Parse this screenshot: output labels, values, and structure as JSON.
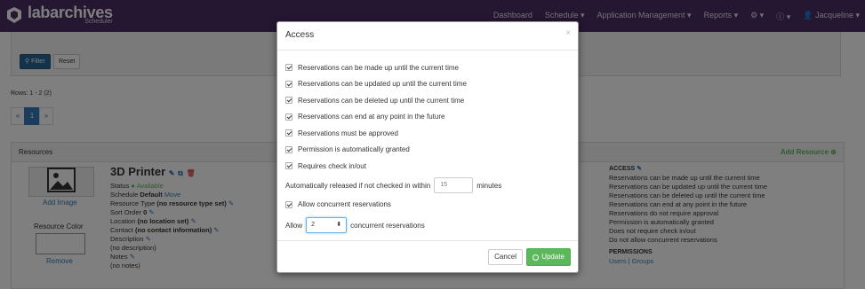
{
  "brand": {
    "name": "labarchives",
    "sub": "Scheduler"
  },
  "nav": {
    "items": [
      "Dashboard",
      "Schedule ▾",
      "Application Management ▾",
      "Reports ▾",
      "⚙ ▾",
      "ⓘ ▾",
      "👤 Jacqueline ▾"
    ]
  },
  "filters": {
    "filter_label": "Filter",
    "reset_label": "Reset"
  },
  "rows_label": "Rows: 1 - 2 (2)",
  "pager": {
    "prev": "«",
    "current": "1",
    "next": "»"
  },
  "resources": {
    "heading": "Resources",
    "add_label": "Add Resource",
    "add_image": "Add Image",
    "resource_color": "Resource Color",
    "remove": "Remove",
    "name": "3D Printer",
    "status_label": "Status",
    "status_value": "Available",
    "schedule_label": "Schedule",
    "schedule_value": "Default",
    "schedule_move": "Move",
    "type_label": "Resource Type",
    "type_value": "(no resource type set)",
    "sort_label": "Sort Order",
    "sort_value": "0",
    "location_label": "Location",
    "location_value": "(no location set)",
    "contact_label": "Contact",
    "contact_value": "(no contact information)",
    "description_label": "Description",
    "description_value": "(no description)",
    "notes_label": "Notes",
    "notes_value": "(no notes)",
    "access_heading": "ACCESS",
    "access_lines": [
      "Reservations can be made up until the current time",
      "Reservations can be updated up until the current time",
      "Reservations can be deleted up until the current time",
      "Reservations can end at any point in the future",
      "Reservations do not require approval",
      "Permission is automatically granted",
      "Does not require check in/out",
      "Do not allow concurrent reservations"
    ],
    "permissions_heading": "PERMISSIONS",
    "permissions_links": "Users | Groups"
  },
  "modal": {
    "title": "Access",
    "close": "×",
    "checks": [
      "Reservations can be made up until the current time",
      "Reservations can be updated up until the current time",
      "Reservations can be deleted up until the current time",
      "Reservations can end at any point in the future",
      "Reservations must be approved",
      "Permission is automatically granted",
      "Requires check in/out"
    ],
    "auto_release_prefix": "Automatically released if not checked in within",
    "auto_release_value": "15",
    "auto_release_suffix": "minutes",
    "concurrent_label": "Allow concurrent reservations",
    "allow_prefix": "Allow",
    "allow_value": "2",
    "allow_suffix": "concurrent reservations",
    "cancel_label": "Cancel",
    "update_label": "Update"
  }
}
